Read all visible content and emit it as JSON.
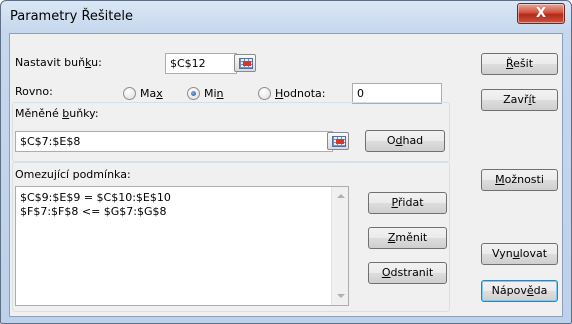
{
  "window": {
    "title": "Parametry Řešitele",
    "close_label": "X"
  },
  "target": {
    "label_pre": "Nastavit buň",
    "label_key": "k",
    "label_post": "u:",
    "value": "$C$12"
  },
  "equal": {
    "label": "Rovno:",
    "options": [
      {
        "pre": "Ma",
        "key": "x",
        "post": "",
        "checked": false
      },
      {
        "pre": "Mi",
        "key": "n",
        "post": "",
        "checked": true
      },
      {
        "pre": "",
        "key": "H",
        "post": "odnota:",
        "checked": false
      }
    ],
    "value": "0"
  },
  "changing": {
    "label_pre": "Měněné ",
    "label_key": "b",
    "label_post": "uňky:",
    "value": "$C$7:$E$8"
  },
  "constraints": {
    "label": "Omezující podmínka:",
    "items": [
      "$C$9:$E$9 = $C$10:$E$10",
      "$F$7:$F$8 <= $G$7:$G$8"
    ]
  },
  "buttons": {
    "solve": {
      "pre": "",
      "key": "Ř",
      "post": "ešit"
    },
    "close": {
      "pre": "Zavř",
      "key": "í",
      "post": "t"
    },
    "guess": {
      "pre": "O",
      "key": "d",
      "post": "had"
    },
    "options": {
      "pre": "",
      "key": "M",
      "post": "ožnosti"
    },
    "add": {
      "pre": "",
      "key": "P",
      "post": "řidat"
    },
    "change": {
      "pre": "",
      "key": "Z",
      "post": "měnit"
    },
    "delete": {
      "pre": "",
      "key": "O",
      "post": "dstranit"
    },
    "reset": {
      "pre": "Vyn",
      "key": "u",
      "post": "lovat"
    },
    "help": {
      "pre": "Nápov",
      "key": "ě",
      "post": "da"
    }
  }
}
